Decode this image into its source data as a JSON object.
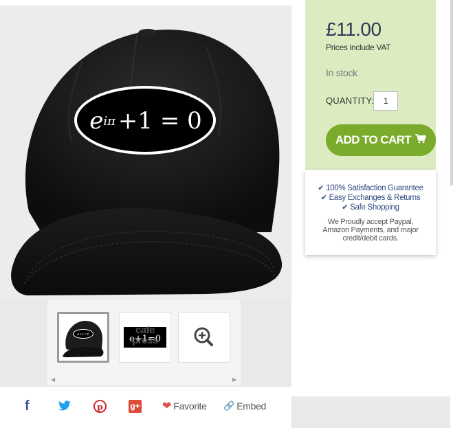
{
  "product": {
    "equation": {
      "base": "e",
      "exponent": "iπ",
      "rest": "+1 = 0"
    }
  },
  "thumbnails": [
    {
      "name": "cap-front-thumbnail"
    },
    {
      "name": "design-thumbnail",
      "watermark": "cafe press"
    },
    {
      "name": "zoom-thumbnail",
      "icon": "zoom-in-icon"
    }
  ],
  "buy_box": {
    "price": "£11.00",
    "vat_note": "Prices include VAT",
    "stock": "In stock",
    "quantity_label": "QUANTITY:",
    "quantity_value": "1",
    "add_to_cart": "ADD TO CART",
    "background": "#dcecc0",
    "button_color": "#7aab2a"
  },
  "guarantees": {
    "items": [
      "100% Satisfaction Guarantee",
      "Easy Exchanges & Returns",
      "Safe Shopping"
    ],
    "payment_note": "We Proudly accept Paypal, Amazon Payments, and major credit/debit cards."
  },
  "share": {
    "favorite": "Favorite",
    "embed": "Embed",
    "icons": [
      "facebook-icon",
      "twitter-icon",
      "pinterest-icon",
      "google-plus-icon",
      "heart-icon",
      "link-icon"
    ],
    "colors": {
      "facebook": "#3b5998",
      "twitter": "#1da1f2",
      "pinterest": "#cb2027",
      "google_plus": "#dd4b39",
      "heart": "#e2504b"
    }
  }
}
